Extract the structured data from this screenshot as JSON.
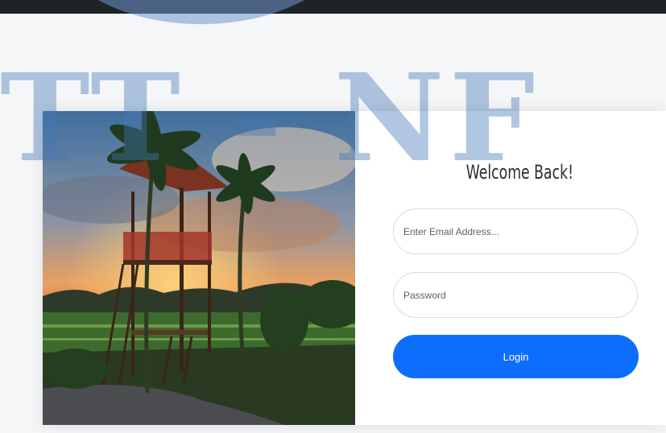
{
  "watermark": {
    "text": "TT - NF"
  },
  "login_card": {
    "title": "Welcome Back!",
    "email_placeholder": "Enter Email Address...",
    "password_placeholder": "Password",
    "login_label": "Login"
  },
  "colors": {
    "accent": "#0d6efd",
    "topbar": "#1f2327",
    "watermark": "#4678b4"
  }
}
